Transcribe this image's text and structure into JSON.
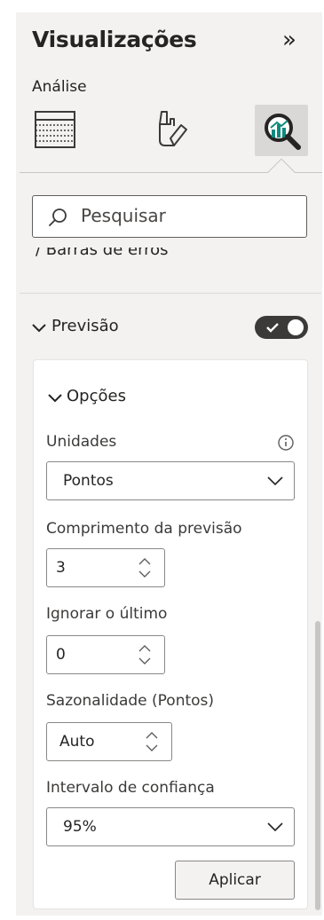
{
  "header": {
    "title": "Visualizações",
    "collapse_glyph": "»",
    "collapse_icon": "double-chevron-right-icon"
  },
  "tabs": {
    "subtitle": "Análise",
    "items": [
      {
        "name": "build-visual",
        "icon": "table-grid-icon",
        "selected": false
      },
      {
        "name": "format-visual",
        "icon": "paintbrush-hand-icon",
        "selected": false
      },
      {
        "name": "analytics",
        "icon": "magnifier-chart-icon",
        "selected": true
      }
    ]
  },
  "search": {
    "placeholder": "Pesquisar",
    "icon": "search-icon"
  },
  "clipped_section": {
    "label": "/ Barras de erros"
  },
  "forecast_section": {
    "title": "Previsão",
    "expanded": true,
    "toggle_on": true,
    "options": {
      "title": "Opções",
      "expanded": true,
      "units": {
        "label": "Unidades",
        "value": "Pontos",
        "info_icon": "info-icon"
      },
      "forecast_length": {
        "label": "Comprimento da previsão",
        "value": "3"
      },
      "ignore_last": {
        "label": "Ignorar o último",
        "value": "0"
      },
      "seasonality": {
        "label": "Sazonalidade (Pontos)",
        "value": "Auto"
      },
      "confidence": {
        "label": "Intervalo de confiança",
        "value": "95%"
      },
      "apply_label": "Aplicar"
    }
  },
  "colors": {
    "pane_bg": "#f3f2f1",
    "card_bg": "#ffffff",
    "text": "#252423",
    "selected_tab_bg": "#d9d8d6",
    "toggle_bg": "#3b3a39",
    "accent_teal": "#118a7e"
  }
}
